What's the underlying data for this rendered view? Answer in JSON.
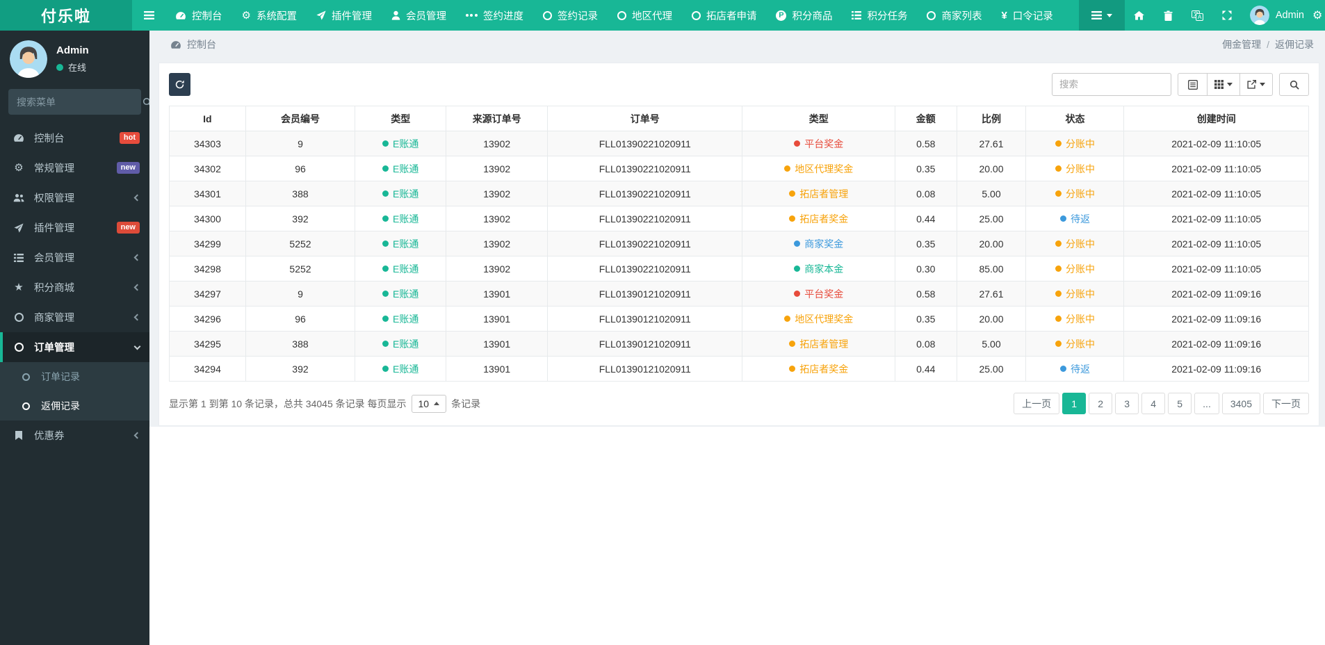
{
  "brand": "付乐啦",
  "palette": {
    "green": "#18b796",
    "red": "#e74c3c",
    "orange": "#f7a30c",
    "blue": "#3c99dc"
  },
  "colors": {
    "navbar": "#18b796",
    "logo_bg": "#119e82",
    "sidebar": "#222d32",
    "accent": "#18b796",
    "refresh_button": "#2c3e50"
  },
  "navbar": {
    "admin_label": "Admin",
    "items": [
      {
        "icon": "dashboard-icon",
        "label": "控制台"
      },
      {
        "icon": "gear-icon",
        "label": "系统配置"
      },
      {
        "icon": "paper-plane-icon",
        "label": "插件管理"
      },
      {
        "icon": "user-icon",
        "label": "会员管理"
      },
      {
        "icon": "ellipsis-icon",
        "label": "签约进度"
      },
      {
        "icon": "circle-icon",
        "label": "签约记录"
      },
      {
        "icon": "circle-icon",
        "label": "地区代理"
      },
      {
        "icon": "circle-icon",
        "label": "拓店者申请"
      },
      {
        "icon": "p-circle-icon",
        "label": "积分商品"
      },
      {
        "icon": "list-icon",
        "label": "积分任务"
      },
      {
        "icon": "circle-icon",
        "label": "商家列表"
      },
      {
        "icon": "yen-icon",
        "label": "口令记录"
      }
    ],
    "tools": [
      "home-icon",
      "trash-icon",
      "translate-icon",
      "expand-icon"
    ]
  },
  "sidebar": {
    "user": {
      "name": "Admin",
      "status": "在线"
    },
    "search_placeholder": "搜索菜单",
    "menu": [
      {
        "icon": "dashboard-icon",
        "label": "控制台",
        "badge": {
          "text": "hot",
          "color": "#e74c3c"
        }
      },
      {
        "icon": "gear-icon",
        "label": "常规管理",
        "badge": {
          "text": "new",
          "color": "#605ca8"
        }
      },
      {
        "icon": "users-icon",
        "label": "权限管理",
        "chevron": "left"
      },
      {
        "icon": "paper-plane-icon",
        "label": "插件管理",
        "badge": {
          "text": "new",
          "color": "#dd4b39"
        }
      },
      {
        "icon": "list-icon",
        "label": "会员管理",
        "chevron": "left"
      },
      {
        "icon": "star-icon",
        "label": "积分商城",
        "chevron": "left"
      },
      {
        "icon": "circle-icon",
        "label": "商家管理",
        "chevron": "left"
      },
      {
        "icon": "circle-icon",
        "label": "订单管理",
        "chevron": "down",
        "active": true,
        "children": [
          {
            "icon": "circle-icon",
            "label": "订单记录"
          },
          {
            "icon": "circle-icon",
            "label": "返佣记录",
            "active": true
          }
        ]
      },
      {
        "icon": "bookmark-icon",
        "label": "优惠券",
        "chevron": "left"
      }
    ]
  },
  "breadcrumb": {
    "section": "控制台",
    "trail": [
      "佣金管理",
      "返佣记录"
    ],
    "separator": "/"
  },
  "toolbar": {
    "search_placeholder": "搜索"
  },
  "table": {
    "columns": [
      "Id",
      "会员编号",
      "类型",
      "来源订单号",
      "订单号",
      "类型",
      "金额",
      "比例",
      "状态",
      "创建时间"
    ],
    "col_widths": [
      "6.7%",
      "9.6%",
      "8%",
      "8.9%",
      "17.1%",
      "13.4%",
      "5.4%",
      "6.1%",
      "8.6%",
      "16.2%"
    ],
    "cell_keys": [
      "id",
      "member_no",
      "account_type",
      "source_order",
      "order_no",
      "bonus_type",
      "amount",
      "ratio",
      "status",
      "created_at"
    ],
    "rows": [
      {
        "id": "34303",
        "member_no": "9",
        "account_type": {
          "text": "E账通",
          "color": "green"
        },
        "source_order": "13902",
        "order_no": "FLL01390221020911",
        "bonus_type": {
          "text": "平台奖金",
          "color": "red"
        },
        "amount": "0.58",
        "ratio": "27.61",
        "status": {
          "text": "分账中",
          "color": "orange"
        },
        "created_at": "2021-02-09 11:10:05"
      },
      {
        "id": "34302",
        "member_no": "96",
        "account_type": {
          "text": "E账通",
          "color": "green"
        },
        "source_order": "13902",
        "order_no": "FLL01390221020911",
        "bonus_type": {
          "text": "地区代理奖金",
          "color": "orange"
        },
        "amount": "0.35",
        "ratio": "20.00",
        "status": {
          "text": "分账中",
          "color": "orange"
        },
        "created_at": "2021-02-09 11:10:05"
      },
      {
        "id": "34301",
        "member_no": "388",
        "account_type": {
          "text": "E账通",
          "color": "green"
        },
        "source_order": "13902",
        "order_no": "FLL01390221020911",
        "bonus_type": {
          "text": "拓店者管理",
          "color": "orange"
        },
        "amount": "0.08",
        "ratio": "5.00",
        "status": {
          "text": "分账中",
          "color": "orange"
        },
        "created_at": "2021-02-09 11:10:05"
      },
      {
        "id": "34300",
        "member_no": "392",
        "account_type": {
          "text": "E账通",
          "color": "green"
        },
        "source_order": "13902",
        "order_no": "FLL01390221020911",
        "bonus_type": {
          "text": "拓店者奖金",
          "color": "orange"
        },
        "amount": "0.44",
        "ratio": "25.00",
        "status": {
          "text": "待返",
          "color": "blue"
        },
        "created_at": "2021-02-09 11:10:05"
      },
      {
        "id": "34299",
        "member_no": "5252",
        "account_type": {
          "text": "E账通",
          "color": "green"
        },
        "source_order": "13902",
        "order_no": "FLL01390221020911",
        "bonus_type": {
          "text": "商家奖金",
          "color": "blue"
        },
        "amount": "0.35",
        "ratio": "20.00",
        "status": {
          "text": "分账中",
          "color": "orange"
        },
        "created_at": "2021-02-09 11:10:05"
      },
      {
        "id": "34298",
        "member_no": "5252",
        "account_type": {
          "text": "E账通",
          "color": "green"
        },
        "source_order": "13902",
        "order_no": "FLL01390221020911",
        "bonus_type": {
          "text": "商家本金",
          "color": "green"
        },
        "amount": "0.30",
        "ratio": "85.00",
        "status": {
          "text": "分账中",
          "color": "orange"
        },
        "created_at": "2021-02-09 11:10:05"
      },
      {
        "id": "34297",
        "member_no": "9",
        "account_type": {
          "text": "E账通",
          "color": "green"
        },
        "source_order": "13901",
        "order_no": "FLL01390121020911",
        "bonus_type": {
          "text": "平台奖金",
          "color": "red"
        },
        "amount": "0.58",
        "ratio": "27.61",
        "status": {
          "text": "分账中",
          "color": "orange"
        },
        "created_at": "2021-02-09 11:09:16"
      },
      {
        "id": "34296",
        "member_no": "96",
        "account_type": {
          "text": "E账通",
          "color": "green"
        },
        "source_order": "13901",
        "order_no": "FLL01390121020911",
        "bonus_type": {
          "text": "地区代理奖金",
          "color": "orange"
        },
        "amount": "0.35",
        "ratio": "20.00",
        "status": {
          "text": "分账中",
          "color": "orange"
        },
        "created_at": "2021-02-09 11:09:16"
      },
      {
        "id": "34295",
        "member_no": "388",
        "account_type": {
          "text": "E账通",
          "color": "green"
        },
        "source_order": "13901",
        "order_no": "FLL01390121020911",
        "bonus_type": {
          "text": "拓店者管理",
          "color": "orange"
        },
        "amount": "0.08",
        "ratio": "5.00",
        "status": {
          "text": "分账中",
          "color": "orange"
        },
        "created_at": "2021-02-09 11:09:16"
      },
      {
        "id": "34294",
        "member_no": "392",
        "account_type": {
          "text": "E账通",
          "color": "green"
        },
        "source_order": "13901",
        "order_no": "FLL01390121020911",
        "bonus_type": {
          "text": "拓店者奖金",
          "color": "orange"
        },
        "amount": "0.44",
        "ratio": "25.00",
        "status": {
          "text": "待返",
          "color": "blue"
        },
        "created_at": "2021-02-09 11:09:16"
      }
    ]
  },
  "footer": {
    "summary_prefix": "显示第 1 到第 10 条记录，总共 34045 条记录 每页显示",
    "page_size": "10",
    "summary_suffix": "条记录",
    "pagination": [
      {
        "label": "上一页"
      },
      {
        "label": "1",
        "active": true
      },
      {
        "label": "2"
      },
      {
        "label": "3"
      },
      {
        "label": "4"
      },
      {
        "label": "5"
      },
      {
        "label": "..."
      },
      {
        "label": "3405"
      },
      {
        "label": "下一页"
      }
    ]
  }
}
